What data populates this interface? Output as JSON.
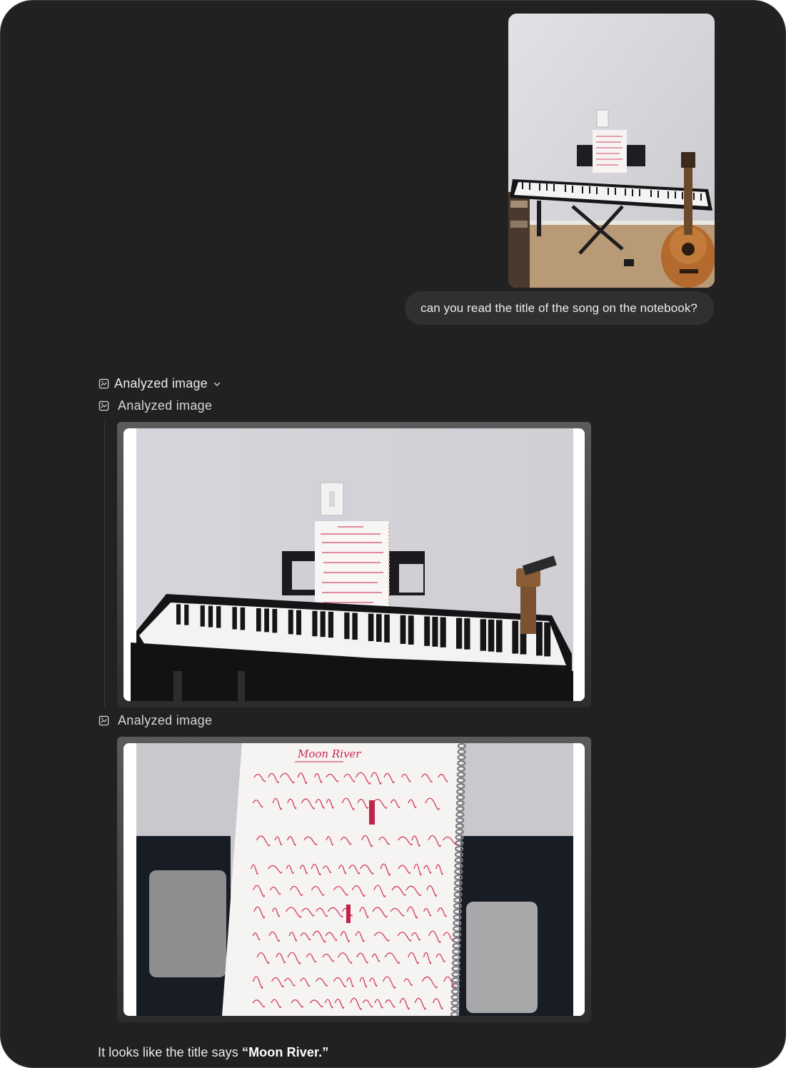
{
  "user_message": {
    "image_icon": "photo-piano-notebook",
    "text": "can you read the title of the song on the notebook?"
  },
  "assistant": {
    "summary_label": "Analyzed image",
    "summary_icon": "image-analyze-icon",
    "expand_icon": "chevron-down-icon",
    "steps": [
      {
        "label": "Analyzed image",
        "icon": "image-analyze-icon"
      },
      {
        "label": "Analyzed image",
        "icon": "image-analyze-icon"
      }
    ],
    "answer_prefix": "It looks like the title says ",
    "answer_emphasis": "“Moon River.”"
  },
  "notebook_heading": "Moon River"
}
